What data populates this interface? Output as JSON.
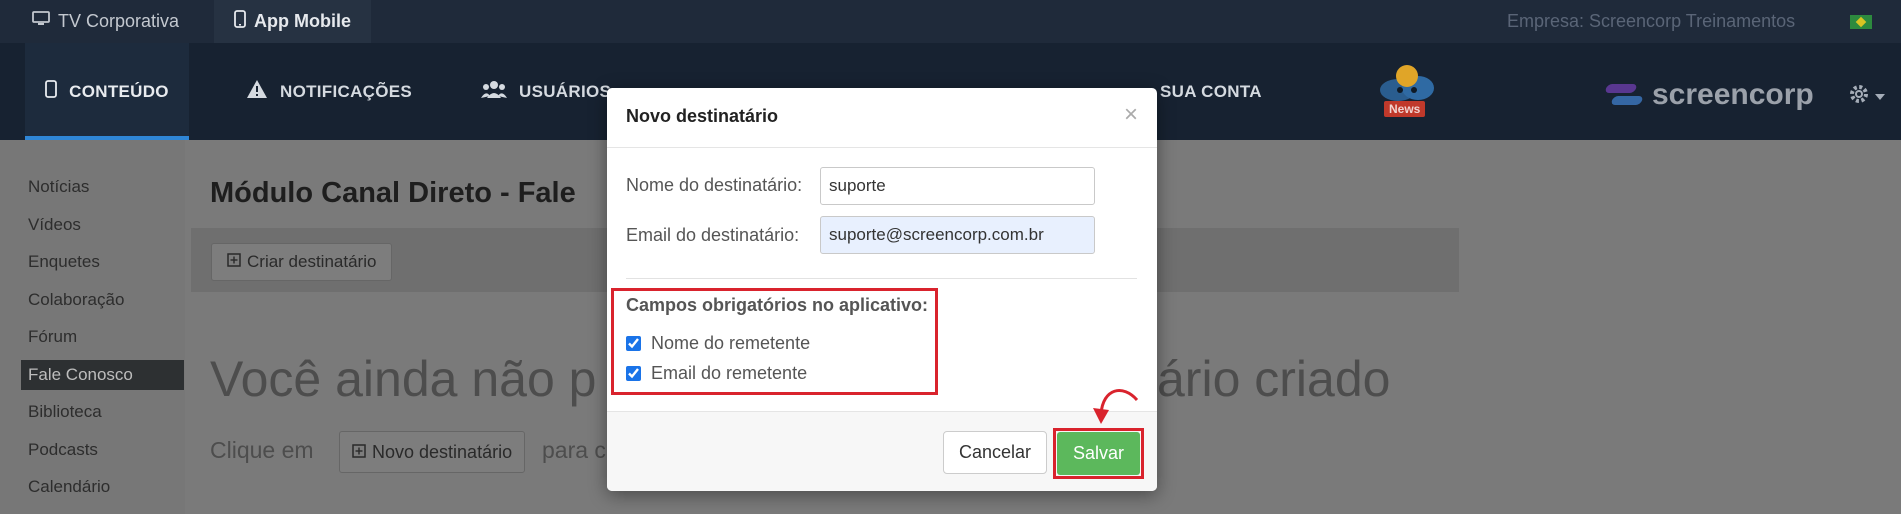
{
  "topbar": {
    "tabs": [
      {
        "label": "TV Corporativa",
        "icon": "monitor-icon"
      },
      {
        "label": "App Mobile",
        "icon": "phone-icon"
      }
    ],
    "company": "Empresa: Screencorp Treinamentos"
  },
  "nav": {
    "items": [
      {
        "label": "CONTEÚDO",
        "icon": "phone-icon"
      },
      {
        "label": "NOTIFICAÇÕES",
        "icon": "warning-icon"
      },
      {
        "label": "USUÁRIOS",
        "icon": "users-icon"
      },
      {
        "label": "SUA CONTA",
        "icon": ""
      }
    ],
    "brand": "screencorp",
    "news_badge": "News"
  },
  "sidebar": {
    "items": [
      {
        "label": "Notícias"
      },
      {
        "label": "Vídeos"
      },
      {
        "label": "Enquetes"
      },
      {
        "label": "Colaboração"
      },
      {
        "label": "Fórum"
      },
      {
        "label": "Fale Conosco"
      },
      {
        "label": "Biblioteca"
      },
      {
        "label": "Podcasts"
      },
      {
        "label": "Calendário"
      }
    ]
  },
  "main": {
    "title": "Módulo Canal Direto - Fale",
    "create_button": "Criar destinatário",
    "empty_left": "Você ainda não p",
    "empty_right": "ário criado",
    "hint_prefix": "Clique em",
    "hint_button": "Novo destinatário",
    "hint_suffix": "para c"
  },
  "modal": {
    "title": "Novo destinatário",
    "close": "×",
    "name_label": "Nome do destinatário:",
    "name_value": "suporte",
    "email_label": "Email do destinatário:",
    "email_value": "suporte@screencorp.com.br",
    "required_title": "Campos obrigatórios no aplicativo:",
    "check_name": "Nome do remetente",
    "check_email": "Email do remetente",
    "cancel": "Cancelar",
    "save": "Salvar"
  },
  "colors": {
    "accent": "#2f86d6",
    "save": "#5cb85c",
    "highlight": "#d9232d"
  }
}
